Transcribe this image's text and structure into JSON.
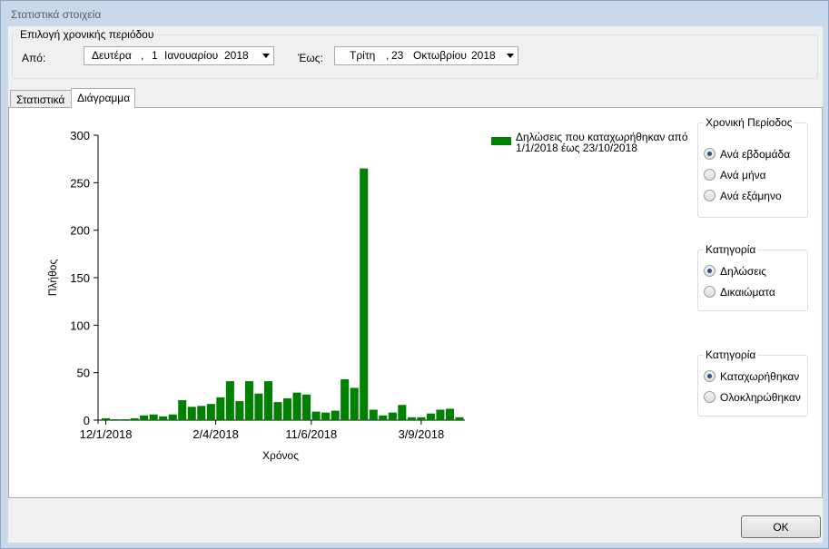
{
  "window": {
    "title": "Στατιστικά στοιχεία"
  },
  "period": {
    "legend": "Επιλογή χρονικής περιόδου",
    "from_label": "Από:",
    "from": {
      "weekday": "Δευτέρα",
      "sep": ",",
      "day": "1",
      "month": "Ιανουαρίου",
      "year": "2018"
    },
    "to_label": "Έως:",
    "to": {
      "weekday": "Τρίτη",
      "sep": ",",
      "day": "23",
      "month": "Οκτωβρίου",
      "year": "2018"
    }
  },
  "tabs": [
    {
      "label": "Στατιστικά",
      "active": false
    },
    {
      "label": "Διάγραμμα",
      "active": true
    }
  ],
  "options": {
    "time_period": {
      "legend": "Χρονική Περίοδος",
      "items": [
        {
          "label": "Ανά εβδομάδα",
          "checked": true
        },
        {
          "label": "Ανά μήνα",
          "checked": false
        },
        {
          "label": "Ανά εξάμηνο",
          "checked": false
        }
      ]
    },
    "category": {
      "legend": "Κατηγορία",
      "items": [
        {
          "label": "Δηλώσεις",
          "checked": true
        },
        {
          "label": "Δικαιώματα",
          "checked": false
        }
      ]
    },
    "status": {
      "legend": "Κατηγορία",
      "items": [
        {
          "label": "Καταχωρήθηκαν",
          "checked": true
        },
        {
          "label": "Ολοκληρώθηκαν",
          "checked": false
        }
      ]
    }
  },
  "buttons": {
    "ok": "OK"
  },
  "chart_data": {
    "type": "bar",
    "title": "",
    "xlabel": "Χρόνος",
    "ylabel": "Πλήθος",
    "ylim": [
      0,
      300
    ],
    "yticks": [
      0,
      50,
      100,
      150,
      200,
      250,
      300
    ],
    "xtick_labels": [
      {
        "label": "12/1/2018",
        "index": 0
      },
      {
        "label": "2/4/2018",
        "index": 11.5
      },
      {
        "label": "11/6/2018",
        "index": 21.5
      },
      {
        "label": "3/9/2018",
        "index": 33
      }
    ],
    "color": "#008000",
    "legend_position": "top-right",
    "series": [
      {
        "name": "Δηλώσεις που καταχωρήθηκαν από 1/1/2018 έως 23/10/2018",
        "values": [
          2,
          1,
          1,
          2,
          5,
          6,
          4,
          6,
          21,
          14,
          15,
          17,
          24,
          41,
          20,
          41,
          28,
          41,
          19,
          23,
          29,
          27,
          9,
          8,
          10,
          43,
          34,
          265,
          11,
          5,
          8,
          16,
          3,
          3,
          7,
          11,
          12,
          3
        ]
      }
    ]
  }
}
